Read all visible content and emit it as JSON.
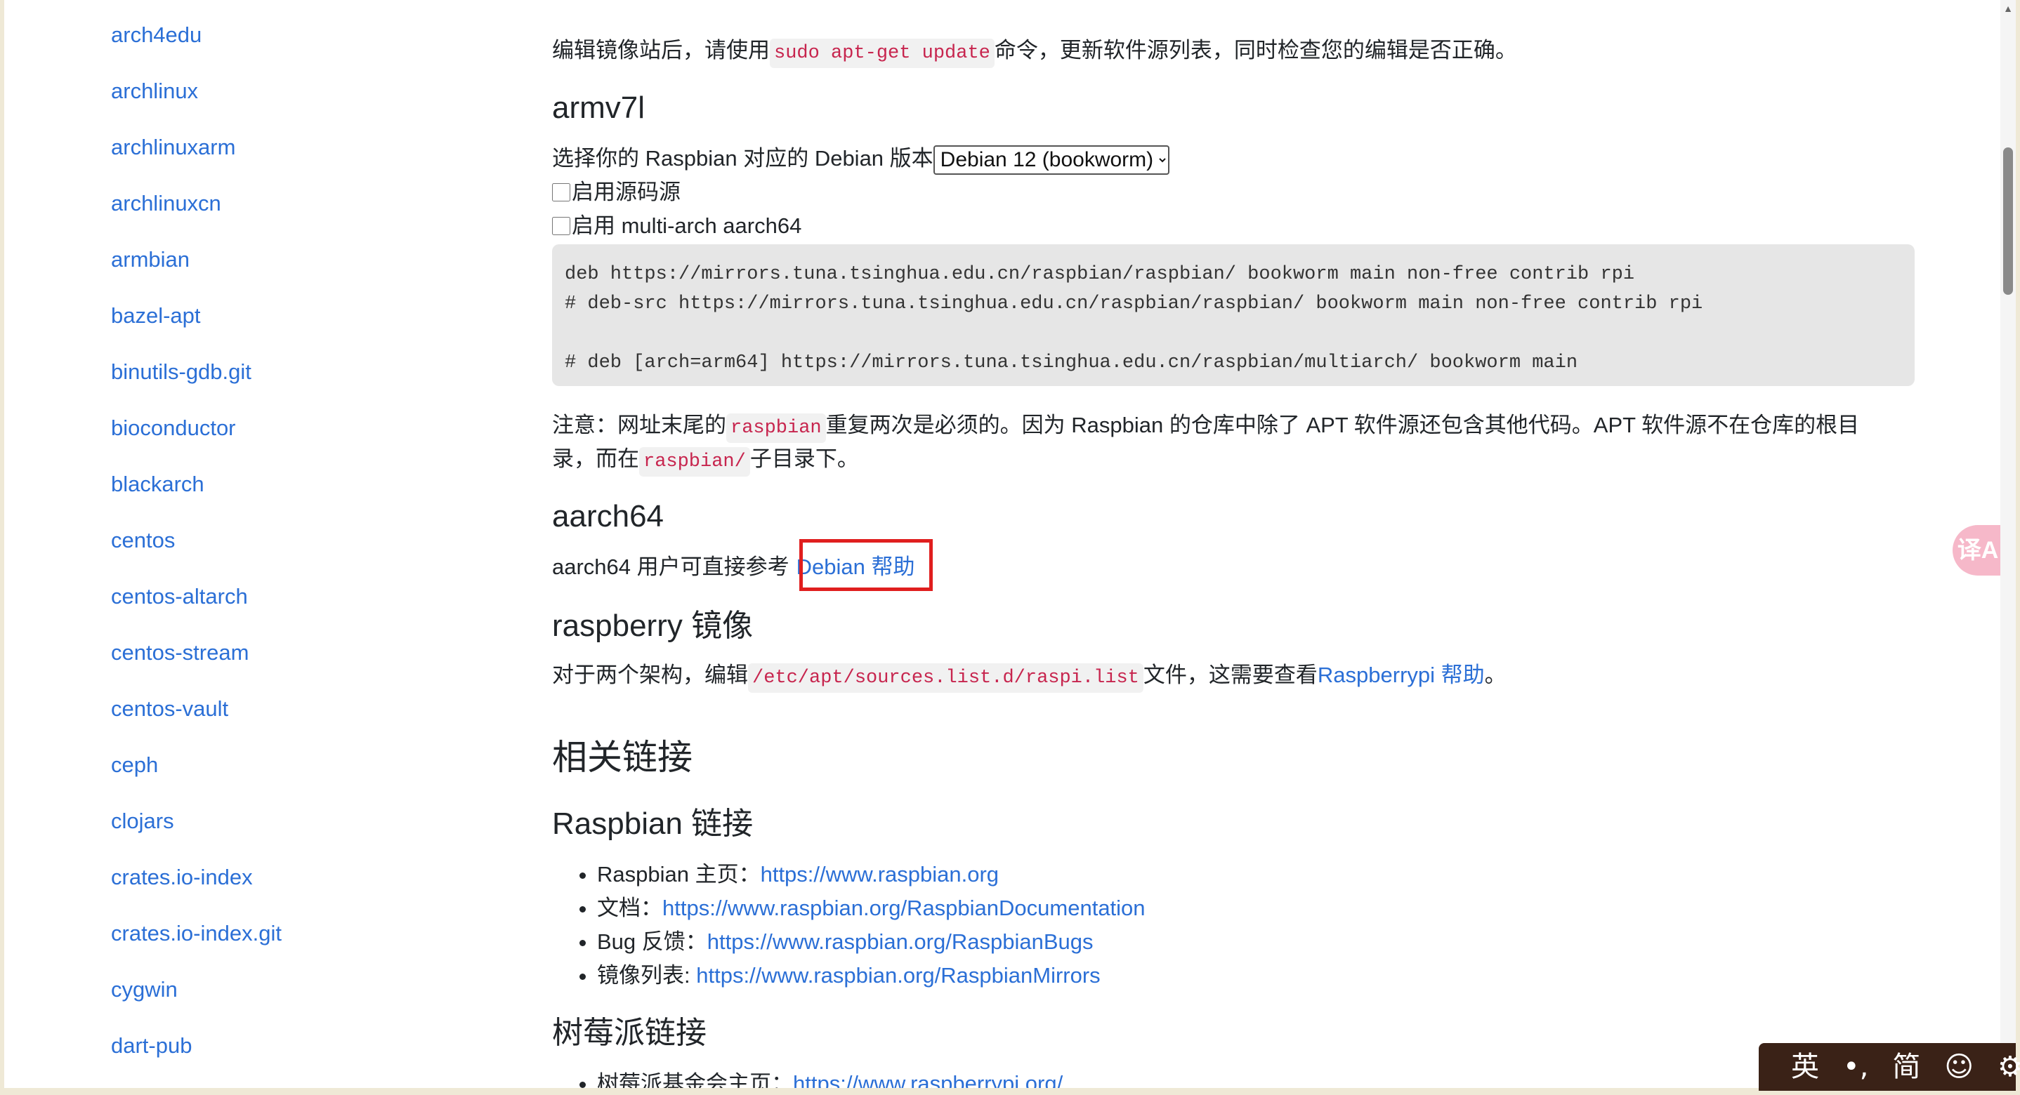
{
  "sidebar": {
    "items": [
      "arch4edu",
      "archlinux",
      "archlinuxarm",
      "archlinuxcn",
      "armbian",
      "bazel-apt",
      "binutils-gdb.git",
      "bioconductor",
      "blackarch",
      "centos",
      "centos-altarch",
      "centos-stream",
      "centos-vault",
      "ceph",
      "clojars",
      "crates.io-index",
      "crates.io-index.git",
      "cygwin",
      "dart-pub"
    ]
  },
  "main": {
    "intro": {
      "before": "编辑镜像站后，请使用",
      "code": "sudo apt-get update",
      "after": "命令，更新软件源列表，同时检查您的编辑是否正确。"
    },
    "armv7l": {
      "title": "armv7l",
      "select_label": "选择你的 Raspbian 对应的 Debian 版本",
      "select_value": "Debian 12 (bookworm)",
      "cb_source": "启用源码源",
      "cb_multiarch": "启用 multi-arch aarch64",
      "code_lines": [
        "deb https://mirrors.tuna.tsinghua.edu.cn/raspbian/raspbian/ bookworm main non-free contrib rpi",
        "# deb-src https://mirrors.tuna.tsinghua.edu.cn/raspbian/raspbian/ bookworm main non-free contrib rpi",
        "",
        "# deb [arch=arm64] https://mirrors.tuna.tsinghua.edu.cn/raspbian/multiarch/ bookworm main"
      ],
      "note_1": "注意：网址末尾的",
      "note_code_1": "raspbian",
      "note_2": "重复两次是必须的。因为 Raspbian 的仓库中除了 APT 软件源还包含其他代码。APT 软件源不在仓库的根目",
      "note_3": "录，而在",
      "note_code_2": "raspbian/",
      "note_4": "子目录下。"
    },
    "aarch64": {
      "title": "aarch64",
      "text": "aarch64 用户可直接参考",
      "link": "Debian 帮助"
    },
    "raspberry": {
      "title": "raspberry 镜像",
      "text_1": "对于两个架构，编辑",
      "code": "/etc/apt/sources.list.d/raspi.list",
      "text_2": "文件，这需要查看",
      "link": "Raspberrypi 帮助",
      "text_3": "。"
    },
    "related": {
      "title": "相关链接",
      "raspbian_title": "Raspbian 链接",
      "raspbian_links": [
        {
          "label": "Raspbian 主页：",
          "url": "https://www.raspbian.org"
        },
        {
          "label": "文档：",
          "url": "https://www.raspbian.org/RaspbianDocumentation"
        },
        {
          "label": "Bug 反馈：",
          "url": "https://www.raspbian.org/RaspbianBugs"
        },
        {
          "label": "镜像列表: ",
          "url": "https://www.raspbian.org/RaspbianMirrors"
        }
      ],
      "pi_title": "树莓派链接",
      "pi_links": [
        {
          "label": "树莓派基金会主页：",
          "url": "https://www.raspberrypi.org/"
        }
      ]
    }
  },
  "ime": {
    "lang": "英",
    "punct": "•,",
    "charset": "简",
    "emoji": "☺",
    "settings": "⚙"
  },
  "translate_icon": "译A",
  "colors": {
    "link": "#2b6fd6",
    "code": "#c7254e",
    "highlight": "#e01e1e",
    "ime_bg": "#3a2217"
  }
}
